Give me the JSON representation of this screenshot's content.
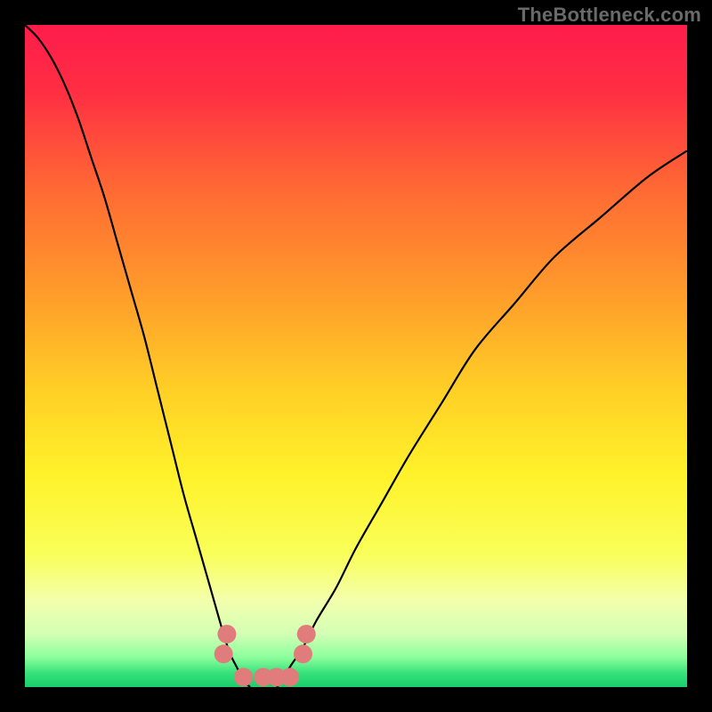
{
  "watermark": "TheBottleneck.com",
  "chart_data": {
    "type": "line",
    "title": "",
    "xlabel": "",
    "ylabel": "",
    "xlim": [
      0,
      100
    ],
    "ylim": [
      0,
      100
    ],
    "grid": false,
    "legend": false,
    "series": [
      {
        "name": "left-branch",
        "x": [
          0,
          2,
          4,
          6,
          8,
          10,
          12,
          14,
          16,
          18,
          20,
          22,
          24,
          26,
          28,
          30,
          31,
          32,
          33,
          34
        ],
        "y": [
          100,
          98,
          95,
          91,
          86,
          80,
          74,
          67,
          60,
          53,
          45,
          37,
          29,
          22,
          15,
          8,
          5,
          3,
          1,
          0
        ]
      },
      {
        "name": "right-branch",
        "x": [
          38,
          39,
          40,
          42,
          44,
          47,
          50,
          54,
          58,
          63,
          68,
          74,
          80,
          87,
          94,
          100
        ],
        "y": [
          0,
          1,
          3,
          6,
          10,
          15,
          21,
          28,
          35,
          43,
          51,
          58,
          65,
          71,
          77,
          81
        ]
      },
      {
        "name": "bottom-markers",
        "x": [
          30,
          30.5,
          33,
          36,
          38,
          40,
          42,
          42.5
        ],
        "y": [
          5,
          8,
          1.5,
          1.5,
          1.5,
          1.5,
          5,
          8
        ]
      }
    ],
    "background_gradient": {
      "stops": [
        {
          "offset": 0.0,
          "color": "#ff1c4b"
        },
        {
          "offset": 0.1,
          "color": "#ff2e43"
        },
        {
          "offset": 0.25,
          "color": "#ff6a34"
        },
        {
          "offset": 0.4,
          "color": "#ff9a2b"
        },
        {
          "offset": 0.55,
          "color": "#ffcf26"
        },
        {
          "offset": 0.68,
          "color": "#fff22a"
        },
        {
          "offset": 0.8,
          "color": "#f9ff5a"
        },
        {
          "offset": 0.87,
          "color": "#f3ffad"
        },
        {
          "offset": 0.92,
          "color": "#d2ffb4"
        },
        {
          "offset": 0.955,
          "color": "#8cff9c"
        },
        {
          "offset": 0.98,
          "color": "#34e07a"
        },
        {
          "offset": 1.0,
          "color": "#19cf6a"
        }
      ]
    },
    "marker_color": "#e17c7c",
    "curve_color": "#000000"
  }
}
